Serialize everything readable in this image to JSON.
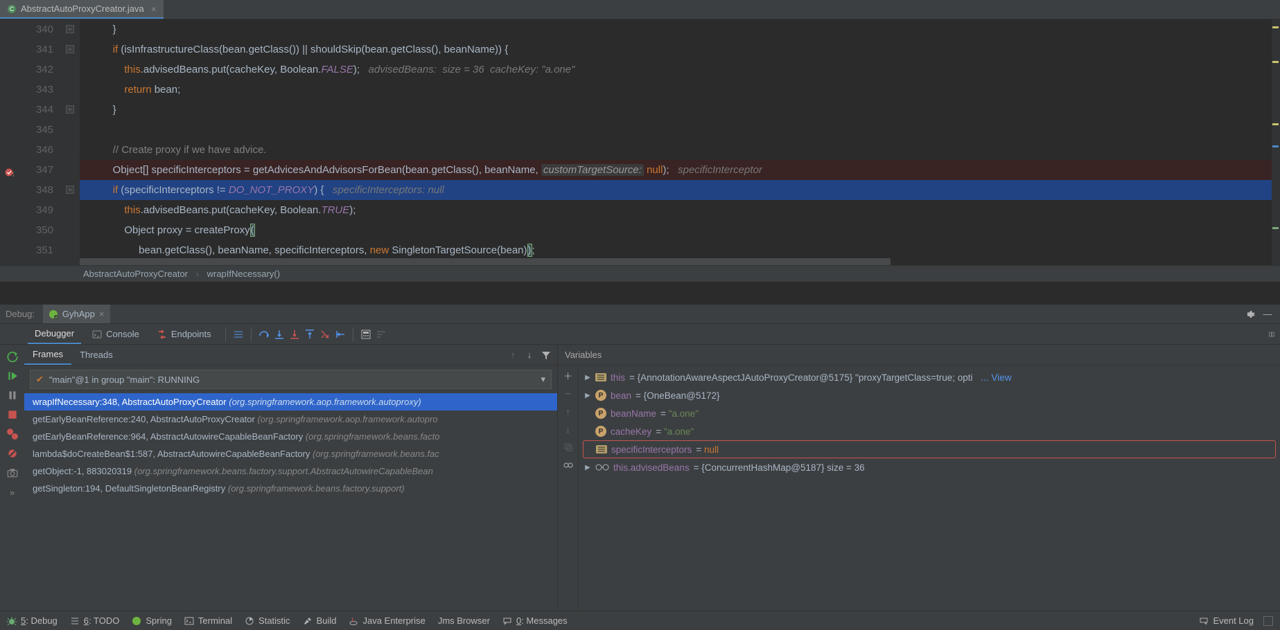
{
  "tab": {
    "label": "AbstractAutoProxyCreator.java"
  },
  "lines": [
    {
      "n": "340",
      "cls": "",
      "html": "          }"
    },
    {
      "n": "341",
      "cls": "",
      "html": "          <span class='kw'>if</span> (isInfrastructureClass(bean.getClass()) || shouldSkip(bean.getClass(), beanName)) {"
    },
    {
      "n": "342",
      "cls": "",
      "html": "              <span class='kw'>this</span>.advisedBeans.put(cacheKey, Boolean.<span class='const'>FALSE</span>);   <span class='hint'>advisedBeans:  size = 36  cacheKey: \"a.one\"</span>"
    },
    {
      "n": "343",
      "cls": "",
      "html": "              <span class='kw'>return</span> bean;"
    },
    {
      "n": "344",
      "cls": "",
      "html": "          }"
    },
    {
      "n": "345",
      "cls": "",
      "html": ""
    },
    {
      "n": "346",
      "cls": "",
      "html": "          <span class='cmt'>// Create proxy if we have advice.</span>"
    },
    {
      "n": "347",
      "cls": "bp",
      "html": "          Object[] specificInterceptors = getAdvicesAndAdvisorsForBean(bean.getClass(), beanName, <span class='param-hint'>customTargetSource:</span> <span class='kw'>null</span>);   <span class='hint'>specificInterceptor</span>"
    },
    {
      "n": "348",
      "cls": "exec",
      "html": "          <span class='kw'>if</span> (specificInterceptors != <span class='const'>DO_NOT_PROXY</span>) {   <span class='hint'>specificInterceptors: null</span>"
    },
    {
      "n": "349",
      "cls": "",
      "html": "              <span class='kw'>this</span>.advisedBeans.put(cacheKey, Boolean.<span class='const'>TRUE</span>);"
    },
    {
      "n": "350",
      "cls": "",
      "html": "              Object proxy = createProxy<span class='brace-hl'>(</span>"
    },
    {
      "n": "351",
      "cls": "",
      "html": "                   bean.getClass(), beanName, specificInterceptors, <span class='kw'>new</span> SingletonTargetSource(bean)<span class='brace-hl'>)</span>;"
    }
  ],
  "breadcrumb": {
    "a": "AbstractAutoProxyCreator",
    "b": "wrapIfNecessary()"
  },
  "debug": {
    "title": "Debug:",
    "config": "GyhApp",
    "tabs": {
      "debugger": "Debugger",
      "console": "Console",
      "endpoints": "Endpoints"
    },
    "framesTabs": {
      "frames": "Frames",
      "threads": "Threads"
    },
    "threadSel": "\"main\"@1 in group \"main\": RUNNING",
    "frames": [
      {
        "m": "wrapIfNecessary:348, AbstractAutoProxyCreator",
        "p": "(org.springframework.aop.framework.autoproxy)",
        "sel": true
      },
      {
        "m": "getEarlyBeanReference:240, AbstractAutoProxyCreator",
        "p": "(org.springframework.aop.framework.autopro"
      },
      {
        "m": "getEarlyBeanReference:964, AbstractAutowireCapableBeanFactory",
        "p": "(org.springframework.beans.facto"
      },
      {
        "m": "lambda$doCreateBean$1:587, AbstractAutowireCapableBeanFactory",
        "p": "(org.springframework.beans.fac"
      },
      {
        "m": "getObject:-1, 883020319",
        "p": "(org.springframework.beans.factory.support.AbstractAutowireCapableBean"
      },
      {
        "m": "getSingleton:194, DefaultSingletonBeanRegistry",
        "p": "(org.springframework.beans.factory.support)"
      }
    ],
    "varsTitle": "Variables",
    "vars": [
      {
        "arrow": "▶",
        "badge": "obj",
        "name": "this",
        "val": "= {AnnotationAwareAspectJAutoProxyCreator@5175} \"proxyTargetClass=true; opti",
        "view": true
      },
      {
        "arrow": "▶",
        "badge": "param",
        "name": "bean",
        "val": "= {OneBean@5172}"
      },
      {
        "arrow": "",
        "badge": "param",
        "name": "beanName",
        "val": "= ",
        "str": "\"a.one\""
      },
      {
        "arrow": "",
        "badge": "param",
        "name": "cacheKey",
        "val": "= ",
        "str": "\"a.one\""
      },
      {
        "arrow": "",
        "badge": "obj",
        "name": "specificInterceptors",
        "nullv": "null",
        "hl": true
      },
      {
        "arrow": "▶",
        "badge": "glasses",
        "name": "this.advisedBeans",
        "val": "= {ConcurrentHashMap@5187}  size = 36"
      }
    ]
  },
  "status": {
    "debug": "Debug",
    "debugN": "5",
    "todo": "TODO",
    "todoN": "6",
    "spring": "Spring",
    "terminal": "Terminal",
    "statistic": "Statistic",
    "build": "Build",
    "je": "Java Enterprise",
    "jms": "Jms Browser",
    "messages": "Messages",
    "messagesN": "0",
    "eventlog": "Event Log"
  }
}
